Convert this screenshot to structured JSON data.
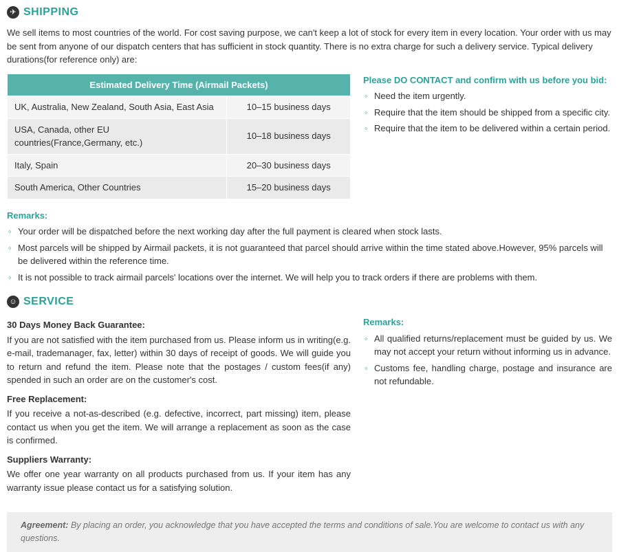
{
  "shipping": {
    "title": "SHIPPING",
    "intro": "We sell items to most countries of the world. For cost saving purpose, we can't keep a lot of stock for every item in every location. Your order with us may be sent from anyone of our dispatch centers that has sufficient in stock quantity. There is no extra charge for such a delivery service. Typical delivery durations(for reference only) are:",
    "table_header": "Estimated Delivery Time (Airmail Packets)",
    "rows": [
      {
        "region": "UK, Australia, New Zealand, South Asia, East Asia",
        "duration": "10–15 business days"
      },
      {
        "region": "USA, Canada, other EU countries(France,Germany, etc.)",
        "duration": "10–18 business days"
      },
      {
        "region": "Italy, Spain",
        "duration": "20–30 business days"
      },
      {
        "region": "South America, Other Countries",
        "duration": "15–20 business days"
      }
    ],
    "contact_heading": "Please DO CONTACT and confirm with us before you bid:",
    "contact_points": [
      "Need the item urgently.",
      "Require that the item should be shipped from a specific city.",
      "Require that the item to be delivered within a certain period."
    ],
    "remarks_label": "Remarks:",
    "remarks": [
      "Your order will be dispatched before the next working day after the full payment is cleared when stock lasts.",
      "Most parcels will be shipped by Airmail packets, it is not guaranteed that parcel should arrive within the time stated above.However, 95% parcels will be delivered within the reference time.",
      "It is not possible to track airmail parcels' locations over the internet. We will help you to track orders if there are problems with them."
    ]
  },
  "service": {
    "title": "SERVICE",
    "guarantee_head": "30 Days Money Back Guarantee:",
    "guarantee_body": "If you are not satisfied with the item purchased from us. Please inform us in writing(e.g. e-mail, trademanager, fax, letter) within 30 days of receipt of goods. We will guide you to return and refund the item. Please note that the postages / custom fees(if any) spended in such an order are on the customer's cost.",
    "replacement_head": "Free Replacement:",
    "replacement_body": "If you receive a not-as-described (e.g. defective, incorrect, part missing) item, please contact us when you get the item. We will arrange a replacement as soon as the case is confirmed.",
    "warranty_head": "Suppliers Warranty:",
    "warranty_body": "We offer one year warranty on all products purchased from us. If your item has any warranty issue please contact us for a satisfying solution.",
    "remarks_label": "Remarks:",
    "remarks": [
      "  All qualified returns/replacement must be guided by us. We may not accept your return without informing us in advance.",
      "  Customs fee, handling charge, postage and insurance are not refundable."
    ]
  },
  "agreement": {
    "label": "Agreement:",
    "text": " By placing an order, you acknowledge that you have accepted the terms and conditions of sale.You are welcome to contact us with any questions."
  }
}
